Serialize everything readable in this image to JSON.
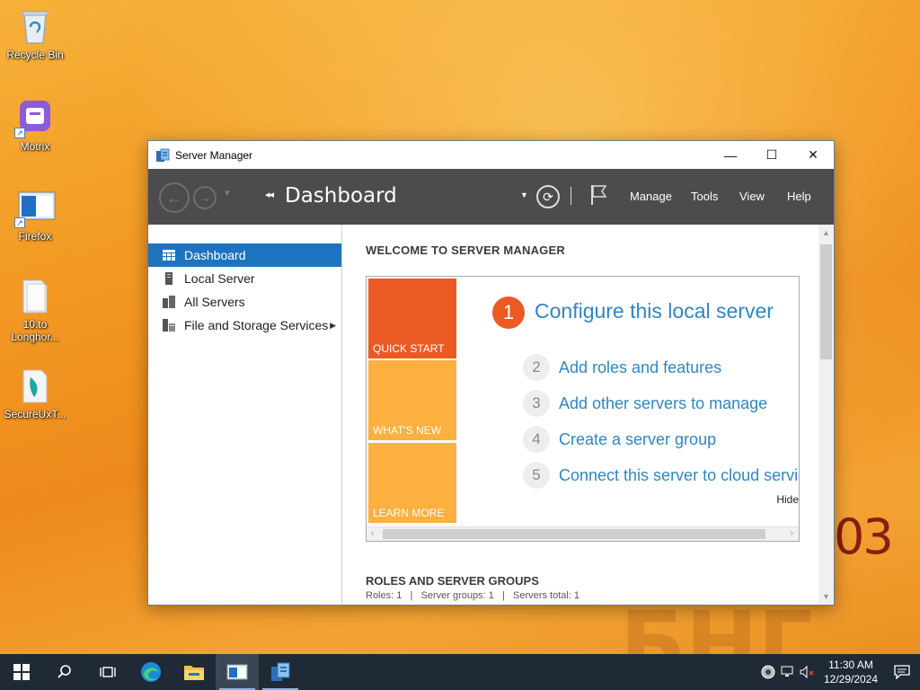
{
  "wallpaper": {
    "corner_text": "03"
  },
  "desktop_icons": [
    {
      "label": "Recycle Bin"
    },
    {
      "label": "Motrix"
    },
    {
      "label": "Firefox"
    },
    {
      "label": "10.to Longhor..."
    },
    {
      "label": "SecureUxT..."
    }
  ],
  "window": {
    "title": "Server Manager",
    "controls": {
      "minimize": "—",
      "maximize": "☐",
      "close": "✕"
    }
  },
  "toolbar": {
    "page_title": "Dashboard",
    "breadcrumb_arrows": "◂◂",
    "menu": [
      "Manage",
      "Tools",
      "View",
      "Help"
    ]
  },
  "sidebar": {
    "items": [
      {
        "label": "Dashboard",
        "icon": "dashboard-grid-icon",
        "active": true
      },
      {
        "label": "Local Server",
        "icon": "server-icon",
        "active": false
      },
      {
        "label": "All Servers",
        "icon": "servers-icon",
        "active": false
      },
      {
        "label": "File and Storage Services",
        "icon": "storage-icon",
        "active": false,
        "has_submenu": true
      }
    ]
  },
  "main": {
    "welcome_heading": "WELCOME TO SERVER MANAGER",
    "tiles": [
      "QUICK START",
      "WHAT'S NEW",
      "LEARN MORE"
    ],
    "primary_step": {
      "number": "1",
      "label": "Configure this local server"
    },
    "steps": [
      {
        "number": "2",
        "label": "Add roles and features"
      },
      {
        "number": "3",
        "label": "Add other servers to manage"
      },
      {
        "number": "4",
        "label": "Create a server group"
      },
      {
        "number": "5",
        "label": "Connect this server to cloud servic"
      }
    ],
    "hide_label": "Hide",
    "roles_heading": "ROLES AND SERVER GROUPS",
    "roles_summary": "Roles: 1   |   Server groups: 1   |   Servers total: 1"
  },
  "colors": {
    "accent_blue": "#1e73be",
    "link_blue": "#2e87c5",
    "quick_start": "#ec5a23",
    "tile_yellow": "#fbb040",
    "toolbar_bg": "#4c4c4c"
  },
  "taskbar": {
    "apps": [
      "start-icon",
      "search-icon",
      "task-view-icon",
      "edge-icon",
      "file-explorer-icon",
      "app-window-icon",
      "server-manager-icon"
    ],
    "clock_time": "11:30 AM",
    "clock_date": "12/29/2024"
  }
}
